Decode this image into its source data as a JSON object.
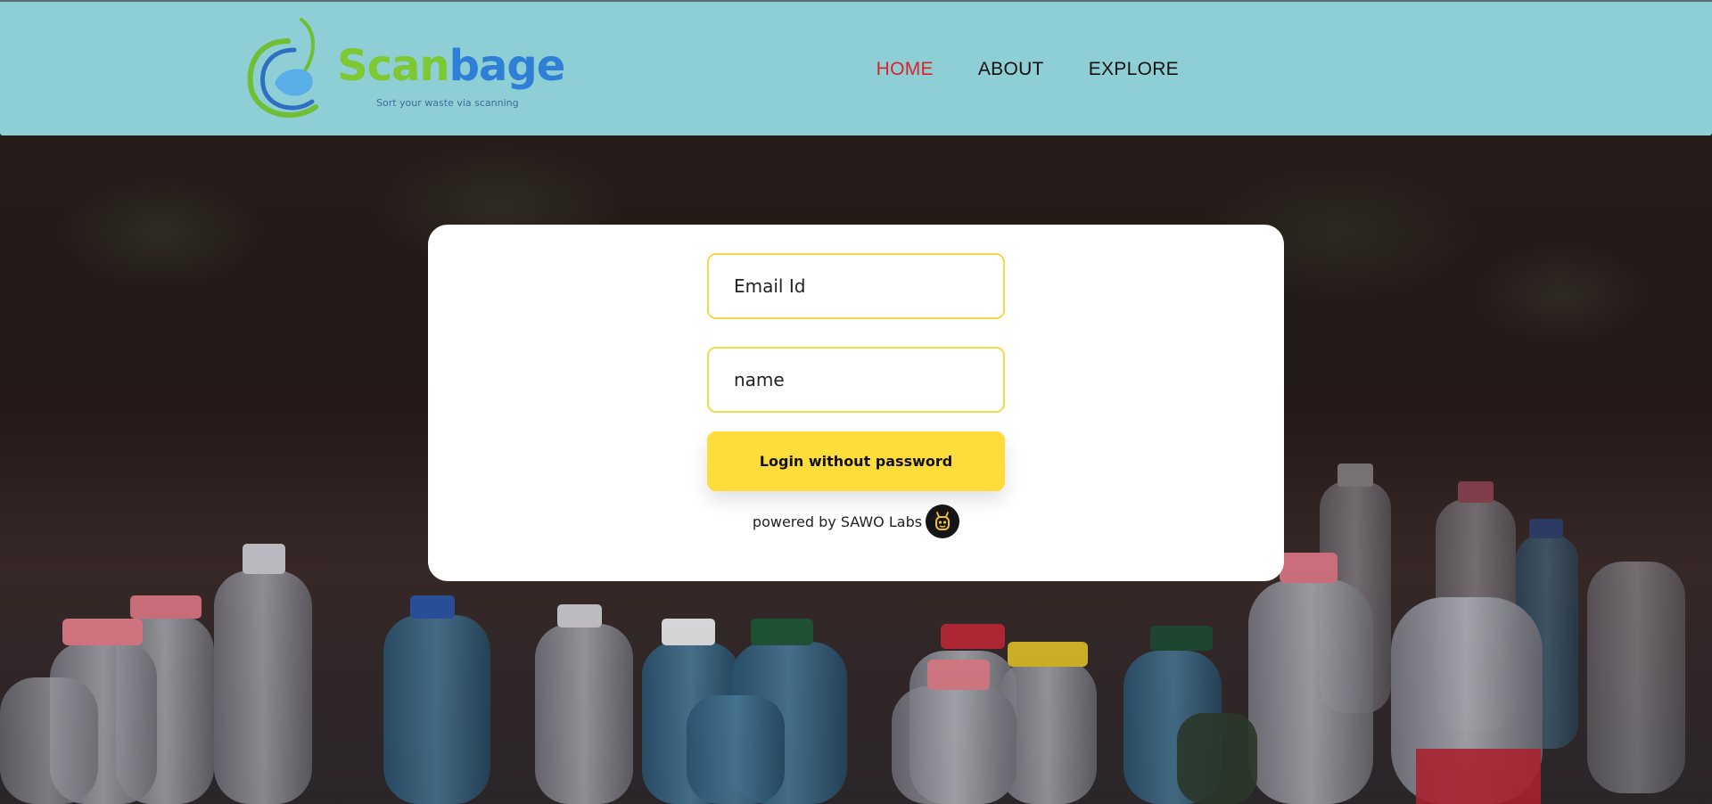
{
  "header": {
    "logo": {
      "word_part1": "Scan",
      "word_part2": "bage",
      "tagline": "Sort your waste via scanning"
    },
    "nav": [
      {
        "label": "HOME",
        "active": true
      },
      {
        "label": "ABOUT",
        "active": false
      },
      {
        "label": "EXPLORE",
        "active": false
      }
    ]
  },
  "login": {
    "email_placeholder": "Email Id",
    "name_placeholder": "name",
    "submit_label": "Login without password",
    "powered_by": "powered by SAWO Labs"
  },
  "colors": {
    "header_bg": "#8ecfd6",
    "nav_active": "#d8232a",
    "button_bg": "#fedd3b",
    "field_border": "#f7d84a",
    "logo_green": "#7ec832",
    "logo_blue": "#2f7fd6"
  },
  "icons": {
    "sawo": "bee-face-icon",
    "logo": "broom-swirl-icon"
  }
}
